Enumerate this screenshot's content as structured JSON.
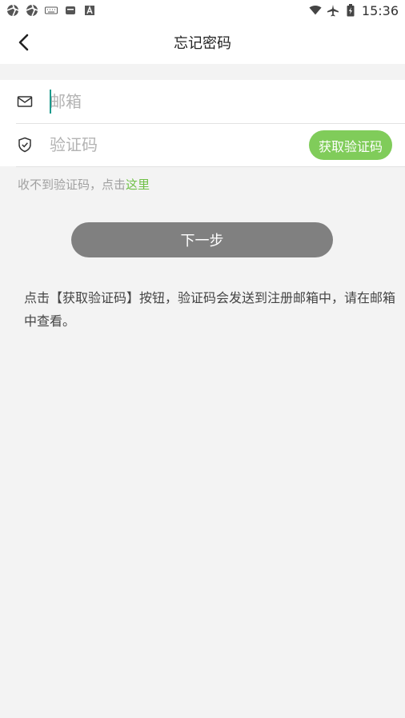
{
  "status_bar": {
    "time": "15:36"
  },
  "header": {
    "title": "忘记密码"
  },
  "form": {
    "email": {
      "placeholder": "邮箱",
      "value": ""
    },
    "code": {
      "placeholder": "验证码",
      "value": ""
    },
    "get_code_label": "获取验证码"
  },
  "hint": {
    "text": "收不到验证码，点击",
    "link_text": "这里"
  },
  "next_button_label": "下一步",
  "description": "点击【获取验证码】按钮，验证码会发送到注册邮箱中，请在邮箱中查看。",
  "colors": {
    "accent_green": "#80cc5a",
    "link_green": "#6fc046",
    "button_gray": "#808080",
    "background": "#f3f3f3"
  }
}
